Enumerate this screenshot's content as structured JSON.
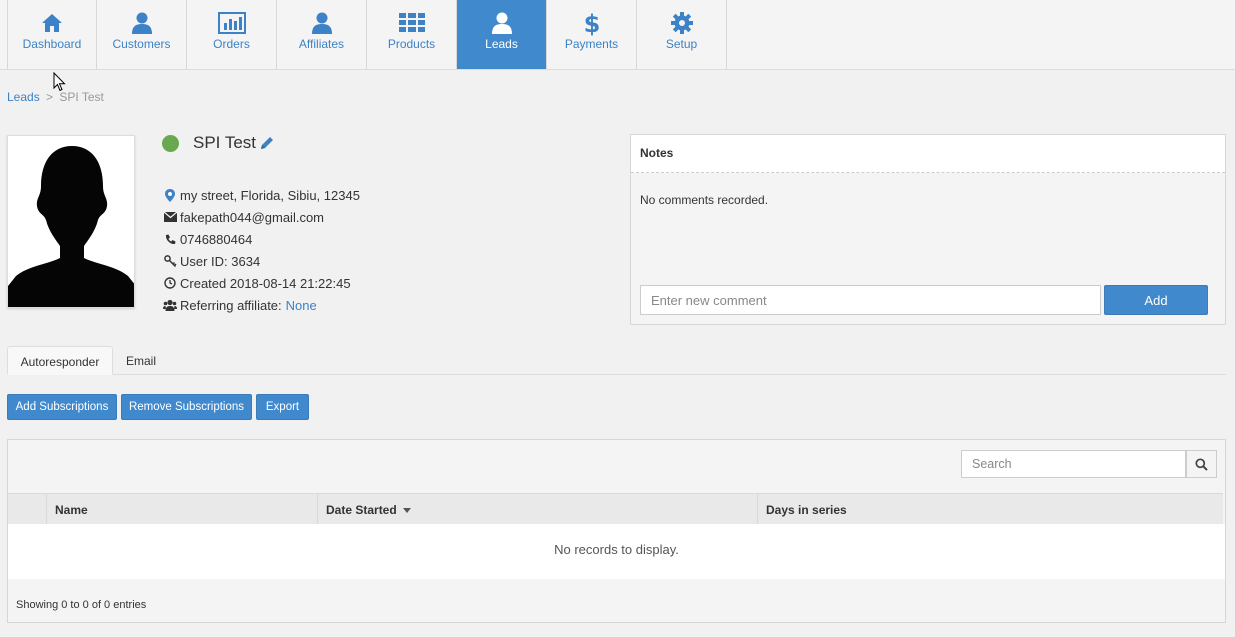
{
  "nav": {
    "tabs": [
      {
        "label": "Dashboard",
        "icon": "home-icon"
      },
      {
        "label": "Customers",
        "icon": "user-icon"
      },
      {
        "label": "Orders",
        "icon": "bar-chart-icon"
      },
      {
        "label": "Affiliates",
        "icon": "user-icon"
      },
      {
        "label": "Products",
        "icon": "grid-icon"
      },
      {
        "label": "Leads",
        "icon": "user-icon",
        "active": true
      },
      {
        "label": "Payments",
        "icon": "dollar-icon"
      },
      {
        "label": "Setup",
        "icon": "gear-icon"
      }
    ]
  },
  "breadcrumb": {
    "parent": "Leads",
    "separator": ">",
    "current": "SPI Test"
  },
  "profile": {
    "name": "SPI Test",
    "status_color": "#6aa84f",
    "address": "my street, Florida, Sibiu, 12345",
    "email": "fakepath044@gmail.com",
    "phone": "0746880464",
    "user_id": "User ID: 3634",
    "created": "Created 2018-08-14 21:22:45",
    "referring_label": "Referring affiliate:",
    "referring_value": "None"
  },
  "notes": {
    "title": "Notes",
    "empty_text": "No comments recorded.",
    "input_placeholder": "Enter new comment",
    "add_label": "Add"
  },
  "tabs": {
    "autoresponder": "Autoresponder",
    "email": "Email"
  },
  "actions": {
    "add_subscriptions": "Add Subscriptions",
    "remove_subscriptions": "Remove Subscriptions",
    "export": "Export"
  },
  "table": {
    "search_placeholder": "Search",
    "columns": [
      "Name",
      "Date Started",
      "Days in series"
    ],
    "empty_text": "No records to display.",
    "footer": "Showing 0 to 0 of 0 entries"
  },
  "colors": {
    "accent": "#4189cd",
    "link": "#3d82c6"
  }
}
